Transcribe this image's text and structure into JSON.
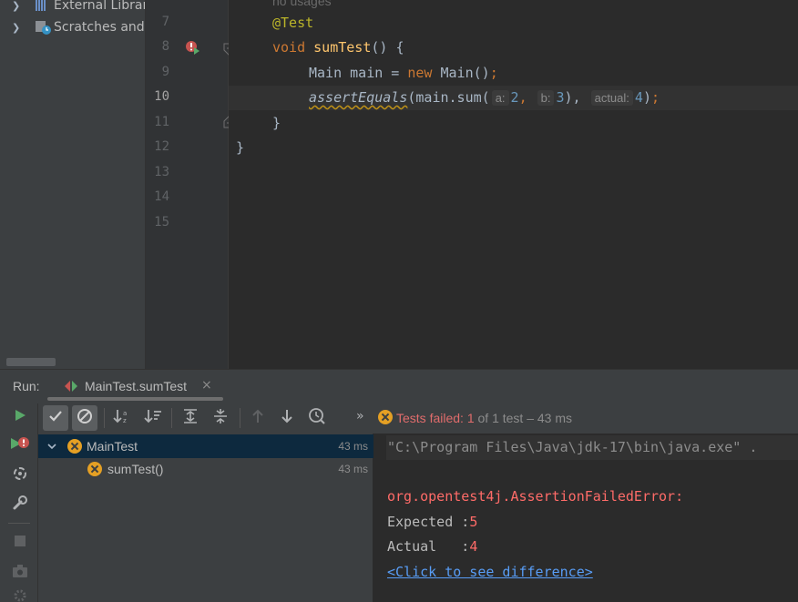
{
  "project_tree": {
    "items": [
      {
        "label": "External Librari"
      },
      {
        "label": "Scratches and "
      }
    ]
  },
  "editor": {
    "line_numbers": [
      "7",
      "8",
      "9",
      "10",
      "11",
      "12",
      "13",
      "14",
      "15"
    ],
    "current_line": "10",
    "usage_hint": "no usages",
    "code": {
      "l7_annotation": "@Test",
      "l8_kw": "void",
      "l8_fn": "sumTest",
      "l8_rest": "() {",
      "l9_a": "Main main = ",
      "l9_kw": "new",
      "l9_b": " Main()",
      "l9_semi": ";",
      "l10_fn": "assertEquals",
      "l10_a": "(main.sum(",
      "l10_hint_a": "a:",
      "l10_val_a": "2",
      "l10_comma1": ",",
      "l10_hint_b": "b:",
      "l10_val_b": "3",
      "l10_close": "),",
      "l10_hint_actual": "actual:",
      "l10_val_actual": "4",
      "l10_end": ")",
      "l10_semi": ";",
      "l11": "}",
      "l12": "}"
    }
  },
  "run": {
    "label": "Run:",
    "tab_title": "MainTest.sumTest",
    "tab_close": "×",
    "status": {
      "prefix": "Tests failed: ",
      "failed": "1",
      "suffix": " of 1 test – 43 ms"
    },
    "overflow": "»"
  },
  "test_tree": {
    "rows": [
      {
        "name": "MainTest",
        "time": "43 ms",
        "status": "failed",
        "expanded": true
      },
      {
        "name": "sumTest()",
        "time": "43 ms",
        "status": "failed"
      }
    ]
  },
  "console": {
    "command": "\"C:\\Program Files\\Java\\jdk-17\\bin\\java.exe\" .",
    "error": "org.opentest4j.AssertionFailedError:",
    "expected_label": "Expected :",
    "expected_value": "5",
    "actual_label": "Actual   :",
    "actual_value": "4",
    "link": "<Click to see difference>"
  },
  "colors": {
    "editor_bg": "#2b2b2b",
    "panel_bg": "#3c3f41",
    "fail": "#e06c6c",
    "warn_icon": "#e5a024",
    "run_green": "#59a869"
  }
}
